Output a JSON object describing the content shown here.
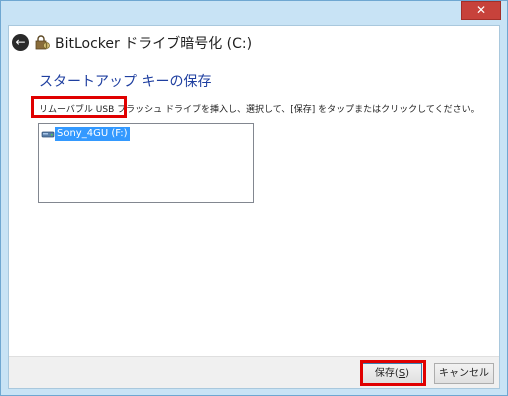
{
  "window": {
    "title": "BitLocker ドライブ暗号化 (C:)",
    "close_glyph": "✕",
    "back_glyph": "←",
    "icon": "bitlocker-icon",
    "colors": {
      "frame": "#c8e3f5",
      "close": "#c7423b",
      "accent_title": "#1f3fa0",
      "selection": "#3399ff",
      "highlight": "#e00000"
    }
  },
  "page": {
    "heading": "スタートアップ キーの保存",
    "instructions": "リムーバブル USB フラッシュ ドライブを挿入し、選択して、[保存] をタップまたはクリックしてください。"
  },
  "drive_list": {
    "items": [
      {
        "label": "Sony_4GU (F:)",
        "icon": "usb-drive-icon",
        "selected": true
      }
    ]
  },
  "footer": {
    "save_label": "保存(",
    "save_accel": "S",
    "save_suffix": ")",
    "cancel_label": "キャンセル"
  }
}
